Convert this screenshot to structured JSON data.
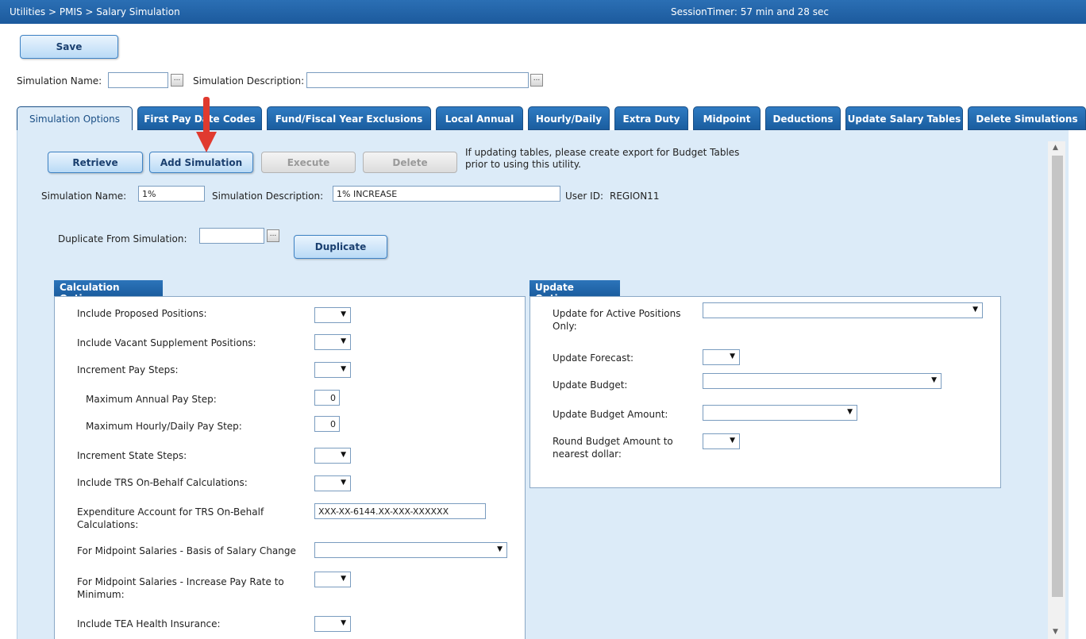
{
  "header": {
    "breadcrumb": "Utilities > PMIS > Salary Simulation",
    "session_timer": "SessionTimer: 57 min and 28 sec"
  },
  "toolbar": {
    "save_label": "Save",
    "simulation_name_label": "Simulation Name:",
    "simulation_name_value": "",
    "simulation_description_label": "Simulation Description:",
    "simulation_description_value": "",
    "ellipsis": "..."
  },
  "tabs": [
    {
      "label": "Simulation Options",
      "active": true
    },
    {
      "label": "First Pay Date Codes"
    },
    {
      "label": "Fund/Fiscal Year Exclusions"
    },
    {
      "label": "Local Annual"
    },
    {
      "label": "Hourly/Daily"
    },
    {
      "label": "Extra Duty"
    },
    {
      "label": "Midpoint"
    },
    {
      "label": "Deductions"
    },
    {
      "label": "Update Salary Tables"
    },
    {
      "label": "Delete Simulations"
    }
  ],
  "actions": {
    "retrieve": "Retrieve",
    "add_simulation": "Add Simulation",
    "execute": "Execute",
    "delete": "Delete",
    "notice_line1": "If updating tables, please create export for Budget Tables",
    "notice_line2": "prior to using this utility."
  },
  "simulation": {
    "name_label": "Simulation Name:",
    "name_value": "1%",
    "description_label": "Simulation Description:",
    "description_value": "1% INCREASE",
    "user_id_label": "User ID:",
    "user_id_value": "REGION11",
    "duplicate_from_label": "Duplicate From Simulation:",
    "duplicate_from_value": "",
    "duplicate_button": "Duplicate"
  },
  "calculation_options": {
    "title": "Calculation Options",
    "include_proposed_positions": "Include Proposed Positions:",
    "include_vacant_supplement_positions": "Include Vacant Supplement Positions:",
    "increment_pay_steps": "Increment Pay Steps:",
    "max_annual_pay_step_label": "Maximum Annual Pay Step:",
    "max_annual_pay_step_value": "0",
    "max_hourly_daily_pay_step_label": "Maximum Hourly/Daily Pay Step:",
    "max_hourly_daily_pay_step_value": "0",
    "increment_state_steps": "Increment State Steps:",
    "include_trs_on_behalf": "Include TRS On-Behalf Calculations:",
    "expenditure_account_label": "Expenditure Account for TRS On-Behalf Calculations:",
    "expenditure_account_value": "XXX-XX-6144.XX-XXX-XXXXXX",
    "midpoint_basis_label": "For Midpoint Salaries - Basis of Salary Change",
    "midpoint_increase_label": "For Midpoint Salaries - Increase Pay Rate to Minimum:",
    "include_tea_health_insurance": "Include TEA Health Insurance:"
  },
  "update_options": {
    "title": "Update Options",
    "active_positions_only": "Update for Active Positions Only:",
    "update_forecast": "Update Forecast:",
    "update_budget": "Update Budget:",
    "update_budget_amount": "Update Budget Amount:",
    "round_budget_amount": "Round Budget Amount to nearest dollar:"
  },
  "glyphs": {
    "dropdown_arrow": "▼",
    "scroll_up": "▲",
    "scroll_down": "▼"
  },
  "colors": {
    "header_blue": "#1c5a9d",
    "panel_bg": "#dcebf8",
    "annotation_red": "#e03a2f"
  }
}
